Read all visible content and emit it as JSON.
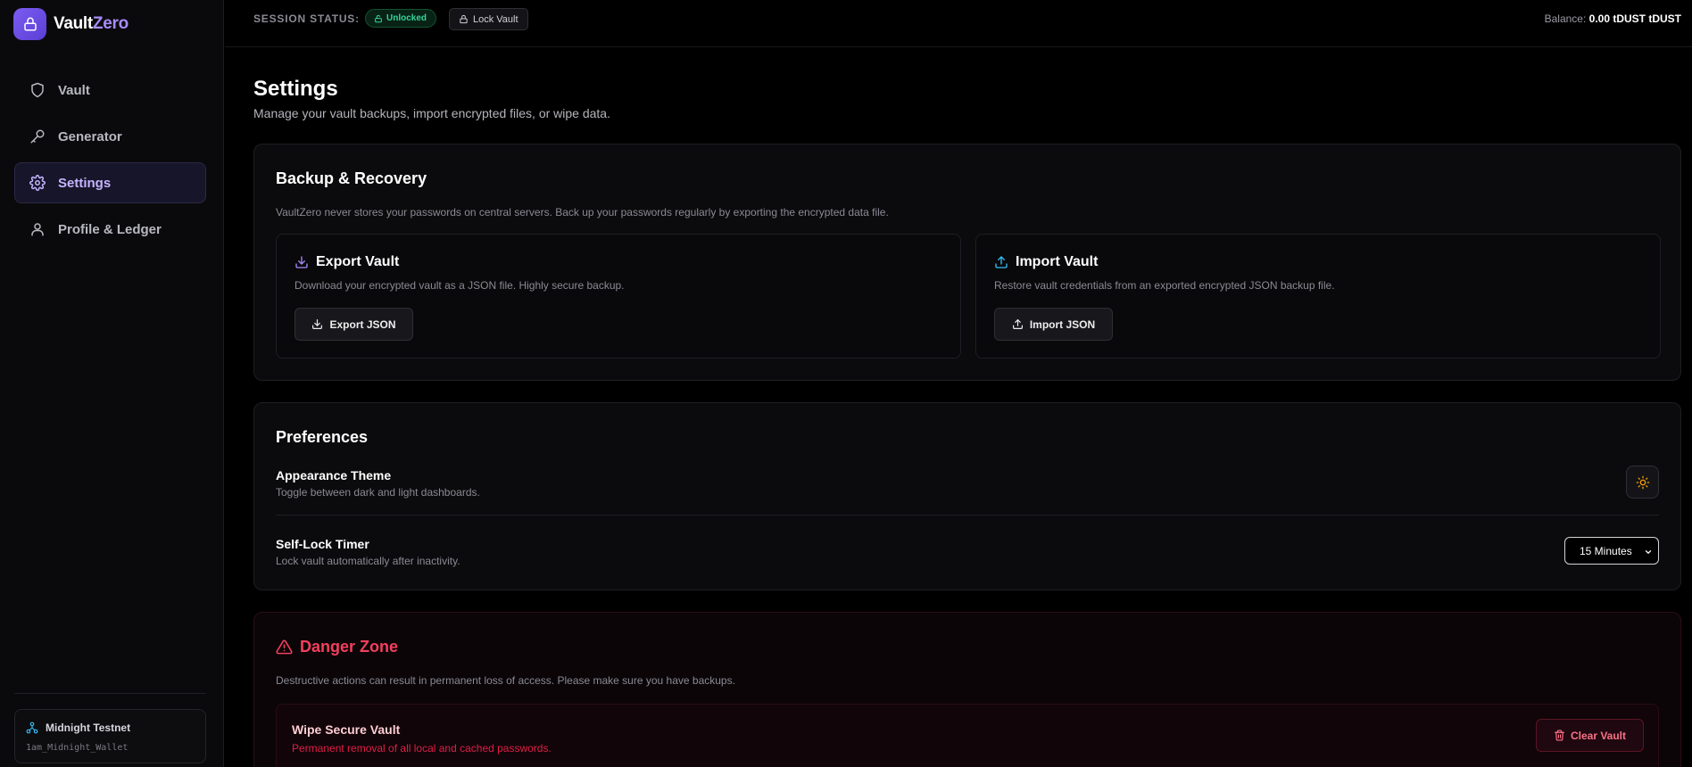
{
  "brand": {
    "name_a": "Vault",
    "name_b": "Zero",
    "icon": "lock-icon",
    "accent": "#7c5cf0"
  },
  "sidebar": {
    "items": [
      {
        "label": "Vault",
        "icon": "shield-icon",
        "active": false
      },
      {
        "label": "Generator",
        "icon": "key-icon",
        "active": false
      },
      {
        "label": "Settings",
        "icon": "gear-icon",
        "active": true
      },
      {
        "label": "Profile & Ledger",
        "icon": "user-icon",
        "active": false
      }
    ],
    "network": {
      "name": "Midnight Testnet",
      "wallet": "1am_Midnight_Wallet",
      "icon": "network-icon"
    }
  },
  "topbar": {
    "session_label": "SESSION STATUS:",
    "status_badge": "Unlocked",
    "lock_button": "Lock Vault",
    "balance_label": "Balance:",
    "balance_value": "0.00 tDUST tDUST"
  },
  "page": {
    "title": "Settings",
    "subtitle": "Manage your vault backups, import encrypted files, or wipe data."
  },
  "backup": {
    "title": "Backup & Recovery",
    "description": "VaultZero never stores your passwords on central servers. Back up your passwords regularly by exporting the encrypted data file.",
    "export": {
      "title": "Export Vault",
      "description": "Download your encrypted vault as a JSON file. Highly secure backup.",
      "button": "Export JSON"
    },
    "import": {
      "title": "Import Vault",
      "description": "Restore vault credentials from an exported encrypted JSON backup file.",
      "button": "Import JSON"
    }
  },
  "preferences": {
    "title": "Preferences",
    "theme": {
      "label": "Appearance Theme",
      "description": "Toggle between dark and light dashboards.",
      "icon": "sun-icon"
    },
    "timer": {
      "label": "Self-Lock Timer",
      "description": "Lock vault automatically after inactivity.",
      "selected": "15 Minutes"
    }
  },
  "danger": {
    "title": "Danger Zone",
    "description": "Destructive actions can result in permanent loss of access. Please make sure you have backups.",
    "wipe": {
      "title": "Wipe Secure Vault",
      "description": "Permanent removal of all local and cached passwords.",
      "button": "Clear Vault"
    },
    "color": "#f43f5e"
  },
  "colors": {
    "success": "#34d399",
    "import_accent": "#38bdf8",
    "export_accent": "#a78bfa",
    "sun": "#f59e0b"
  }
}
